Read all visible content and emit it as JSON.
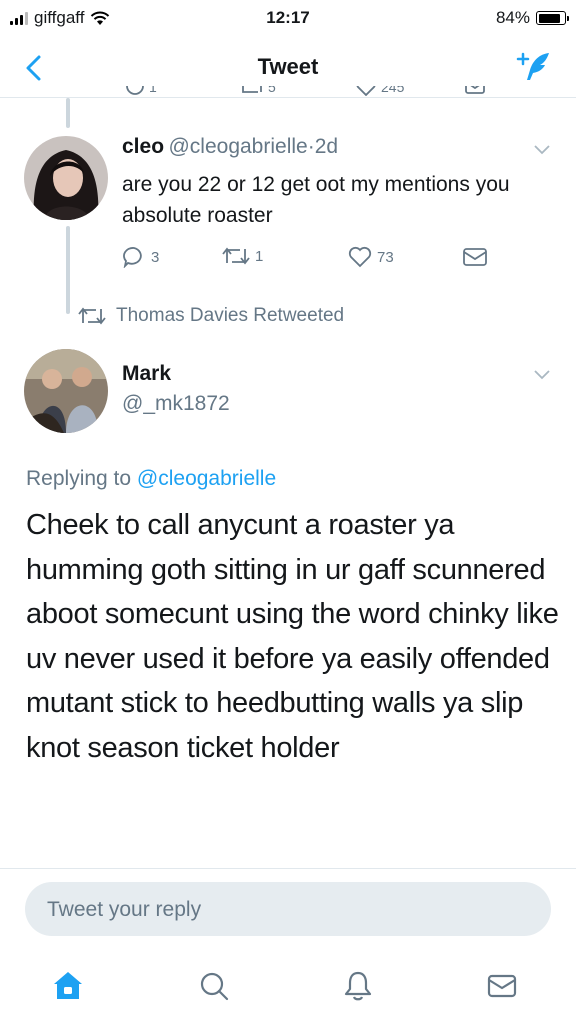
{
  "status_bar": {
    "carrier": "giffgaff",
    "time": "12:17",
    "battery": "84%",
    "battery_level": 0.84
  },
  "nav": {
    "title": "Tweet"
  },
  "colors": {
    "accent": "#1da1f2",
    "secondary_text": "#657786",
    "divider": "#e1e8ed",
    "reply_box": "#e6ecf0"
  },
  "parent_tweet_partial_actions": {
    "replies": "1",
    "retweets": "5",
    "likes": "245"
  },
  "reply_tweet": {
    "name": "cleo",
    "handle": "@cleogabrielle",
    "separator": "·",
    "time": "2d",
    "text": "are you 22 or 12 get oot my mentions you absolute roaster",
    "replies": "3",
    "retweets": "1",
    "likes": "73"
  },
  "retweet_context": "Thomas Davies Retweeted",
  "main_tweet": {
    "name": "Mark",
    "handle": "@_mk1872",
    "replying_prefix": "Replying to ",
    "replying_handle": "@cleogabrielle",
    "text": "Cheek to call anycunt a roaster ya humming goth sitting in ur gaff scunnered aboot somecunt using the word chinky like uv never used it before ya easily offended mutant stick to heedbutting walls ya slip knot season ticket holder"
  },
  "reply_input": {
    "placeholder": "Tweet your reply"
  },
  "tabs": {
    "icons": [
      "home-icon",
      "search-icon",
      "notifications-icon",
      "messages-icon"
    ]
  }
}
